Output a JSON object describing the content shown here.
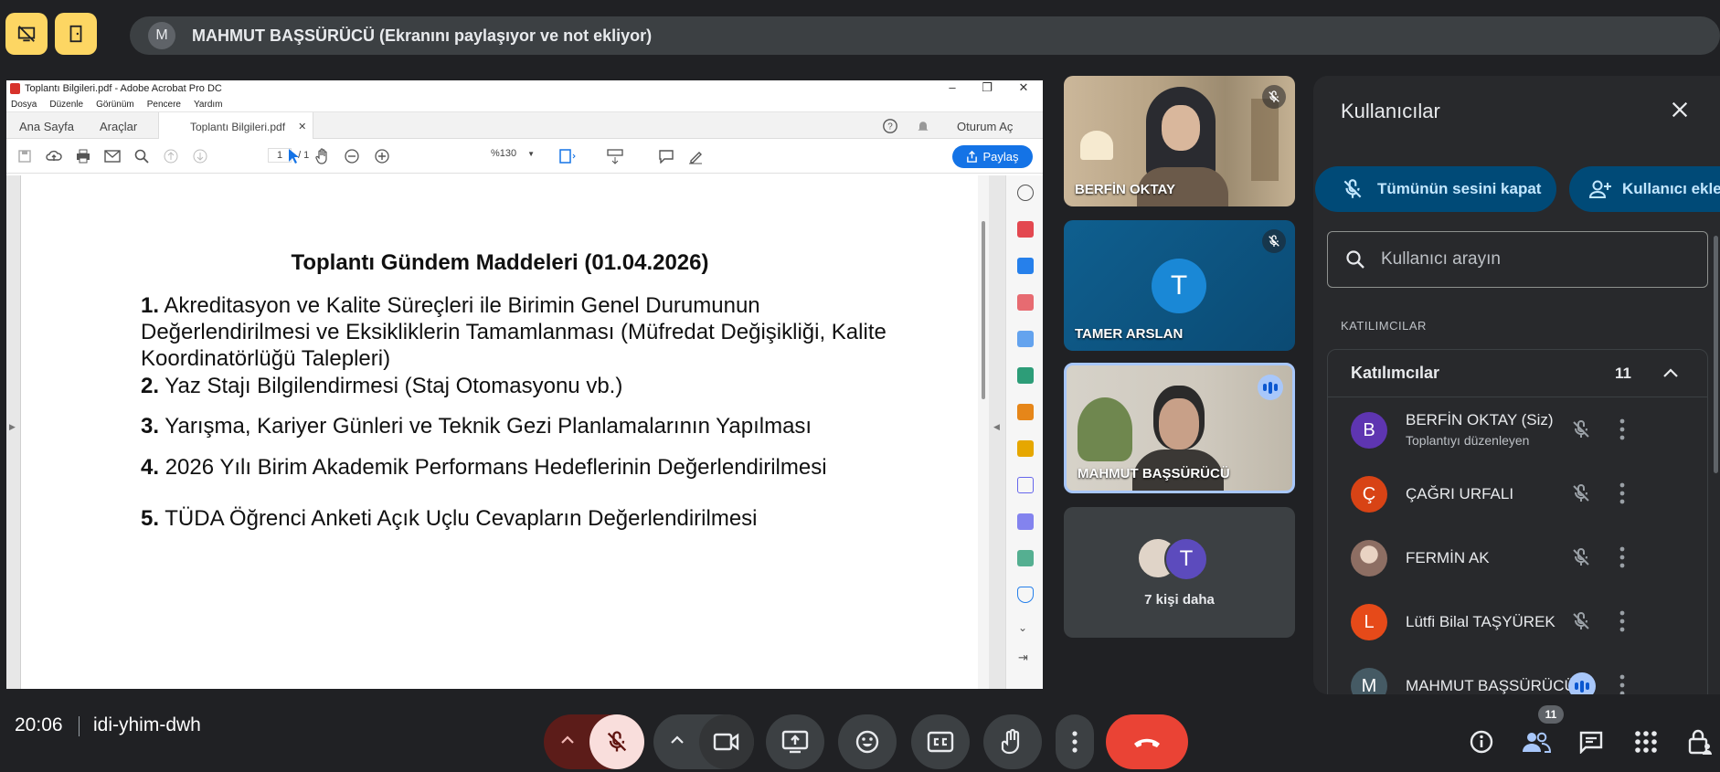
{
  "presenter": {
    "avatar_letter": "M",
    "text": "MAHMUT BAŞSÜRÜCÜ (Ekranını paylaşıyor ve not ekliyor)"
  },
  "acrobat": {
    "window_title": "Toplantı Bilgileri.pdf - Adobe Acrobat Pro DC",
    "menu": [
      "Dosya",
      "Düzenle",
      "Görünüm",
      "Pencere",
      "Yardım"
    ],
    "tabs": {
      "home": "Ana Sayfa",
      "tools": "Araçlar",
      "document": "Toplantı Bilgileri.pdf"
    },
    "sign_in": "Oturum Aç",
    "page_current": "1",
    "page_total": "/ 1",
    "zoom": "%130",
    "share": "Paylaş"
  },
  "document": {
    "title": "Toplantı Gündem Maddeleri (01.04.2026)",
    "items": [
      {
        "num": "1.",
        "text": "Akreditasyon ve Kalite Süreçleri ile Birimin Genel Durumunun Değerlendirilmesi ve Eksikliklerin Tamamlanması (Müfredat Değişikliği, Kalite Koordinatörlüğü Talepleri)"
      },
      {
        "num": "2.",
        "text": "Yaz Stajı Bilgilendirmesi (Staj Otomasyonu vb.)"
      },
      {
        "num": "3.",
        "text": "Yarışma, Kariyer Günleri ve Teknik Gezi Planlamalarının Yapılması"
      },
      {
        "num": "4.",
        "text": "2026 Yılı Birim Akademik Performans Hedeflerinin Değerlendirilmesi"
      },
      {
        "num": "5.",
        "text": "TÜDA Öğrenci Anketi Açık Uçlu Cevapların Değerlendirilmesi"
      }
    ]
  },
  "tiles": [
    {
      "name": "BERFİN OKTAY"
    },
    {
      "name": "TAMER ARSLAN",
      "avatar_letter": "T"
    },
    {
      "name": "MAHMUT BAŞSÜRÜCÜ"
    },
    {
      "more_text": "7 kişi daha",
      "avatar_letter": "T"
    }
  ],
  "panel": {
    "title": "Kullanıcılar",
    "mute_all": "Tümünün sesini kapat",
    "add_people": "Kullanıcı ekle",
    "search_placeholder": "Kullanıcı arayın",
    "section_label": "KATILIMCILAR",
    "group_label": "Katılımcılar",
    "group_count": "11",
    "participants": [
      {
        "letter": "B",
        "name": "BERFİN OKTAY (Siz)",
        "sub": "Toplantıyı düzenleyen",
        "color": "#5e35b1"
      },
      {
        "letter": "Ç",
        "name": "ÇAĞRI URFALI",
        "color": "#d84315"
      },
      {
        "letter": "",
        "name": "FERMİN AK",
        "color": "#8d6e63"
      },
      {
        "letter": "L",
        "name": "Lütfi Bilal TAŞYÜREK",
        "color": "#e64a19"
      },
      {
        "letter": "M",
        "name": "MAHMUT BAŞSÜRÜCÜ",
        "color": "#455a64"
      }
    ]
  },
  "bottom": {
    "time": "20:06",
    "meeting_code": "idi-yhim-dwh",
    "people_count": "11"
  },
  "colors": {
    "accent_yellow": "#fdd663",
    "end_call": "#ea4335",
    "mic_off_bg": "#f9dedc",
    "share_blue": "#1473e6"
  }
}
